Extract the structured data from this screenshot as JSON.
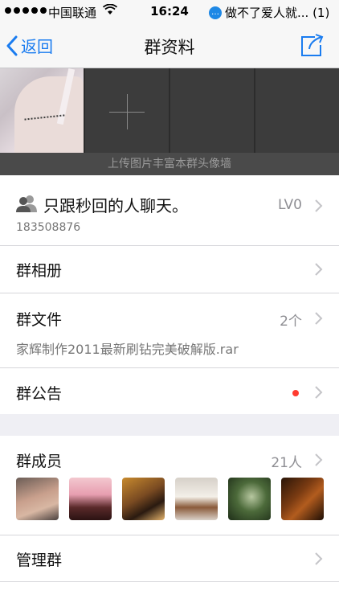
{
  "status_bar": {
    "carrier": "中国联通",
    "time": "16:24",
    "notification": "做不了爱人就... (1)"
  },
  "nav": {
    "back_label": "返回",
    "title": "群资料"
  },
  "gallery": {
    "caption": "上传图片丰富本群头像墙"
  },
  "group": {
    "name": "只跟秒回的人聊天。",
    "level": "LV0",
    "id": "183508876"
  },
  "rows": {
    "album": "群相册",
    "files_label": "群文件",
    "files_count": "2个",
    "files_latest": "家辉制作2011最新刷钻完美破解版.rar",
    "announcement": "群公告"
  },
  "members": {
    "label": "群成员",
    "count": "21人"
  },
  "manage": {
    "label": "管理群"
  },
  "accent_color": "#1a7cf0"
}
